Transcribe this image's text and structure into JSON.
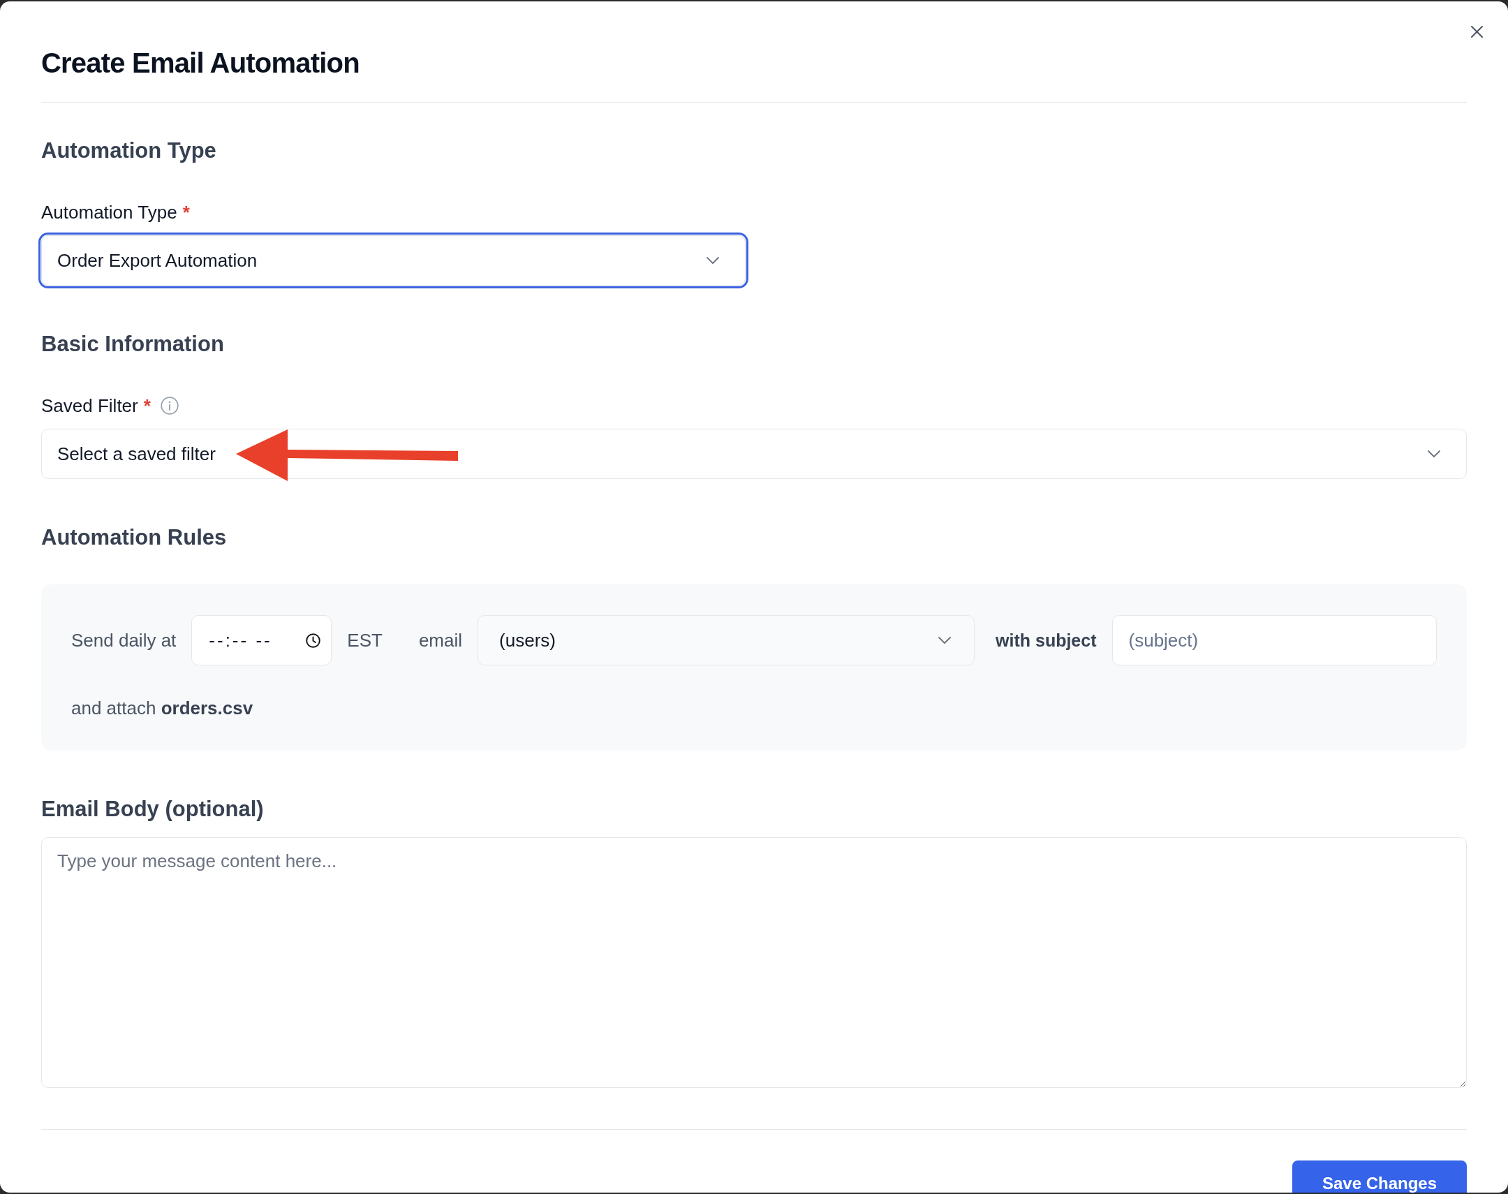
{
  "dialog": {
    "title": "Create Email Automation"
  },
  "sections": [
    {
      "kind": "automation_type",
      "heading": "Automation Type",
      "field": {
        "label": "Automation Type",
        "required_mark": "*",
        "value": "Order Export Automation",
        "focused": true
      }
    },
    {
      "kind": "basic_information",
      "heading": "Basic Information",
      "field": {
        "label": "Saved Filter",
        "required_mark": "*",
        "info_icon": true,
        "placeholder": "Select a saved filter",
        "focused": false,
        "annotation": {
          "kind": "arrow"
        }
      }
    },
    {
      "kind": "automation_rules",
      "heading": "Automation Rules",
      "lines": [
        {
          "parts": [
            {
              "kind": "text",
              "text": "Send daily at",
              "bold": false
            },
            {
              "kind": "time",
              "placeholder": "--:-- --"
            },
            {
              "kind": "timezone",
              "text": "EST"
            },
            {
              "kind": "text",
              "text": "email",
              "bold": false
            },
            {
              "kind": "select",
              "value": "(users)"
            },
            {
              "kind": "text",
              "text": "with subject",
              "bold": true
            },
            {
              "kind": "input",
              "placeholder": "(subject)"
            }
          ]
        },
        {
          "parts": [
            {
              "kind": "text",
              "text": "and attach **orders.csv**",
              "bold": false
            }
          ]
        }
      ]
    },
    {
      "kind": "email_body",
      "heading": "Email Body (optional)",
      "placeholder": "Type your message content here..."
    }
  ],
  "footer": {
    "buttons": [
      {
        "kind": "primary",
        "label": "Save Changes"
      }
    ]
  }
}
